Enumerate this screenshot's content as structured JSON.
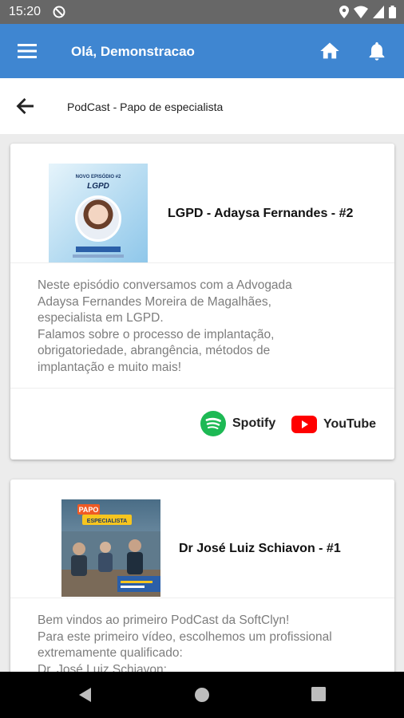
{
  "status_bar": {
    "time": "15:20"
  },
  "app_bar": {
    "greeting": "Olá, Demonstracao",
    "menu_icon": "hamburger-menu-icon",
    "home_icon": "home-icon",
    "bell_icon": "notification-bell-icon",
    "color": "#3f86d1"
  },
  "subheader": {
    "title": "PodCast - Papo de especialista",
    "back_icon": "arrow-back-icon"
  },
  "episodes": [
    {
      "title": "LGPD - Adaysa Fernandes - #2",
      "thumb_line1": "NOVO EPISÓDIO #2",
      "thumb_line2": "LGPD",
      "description_lines": [
        "Neste episódio conversamos com a Advogada",
        "Adaysa Fernandes Moreira de Magalhães,",
        "especialista em LGPD.",
        "Falamos sobre o processo de implantação,",
        "obrigatoriedade, abrangência, métodos de",
        "implantação e muito mais!"
      ],
      "links": [
        {
          "label": "Spotify",
          "icon": "spotify-icon",
          "color": "#1db954"
        },
        {
          "label": "YouTube",
          "icon": "youtube-icon",
          "color": "#ff0000"
        }
      ]
    },
    {
      "title": "Dr José Luiz Schiavon - #1",
      "thumb_logo_line1": "PAPO",
      "thumb_logo_line2": "ESPECIALISTA",
      "description_lines": [
        "Bem vindos ao primeiro PodCast da SoftClyn!",
        "Para este primeiro vídeo, escolhemos um profissional",
        "extremamente qualificado:",
        "Dr. José Luiz Schiavon;"
      ]
    }
  ]
}
